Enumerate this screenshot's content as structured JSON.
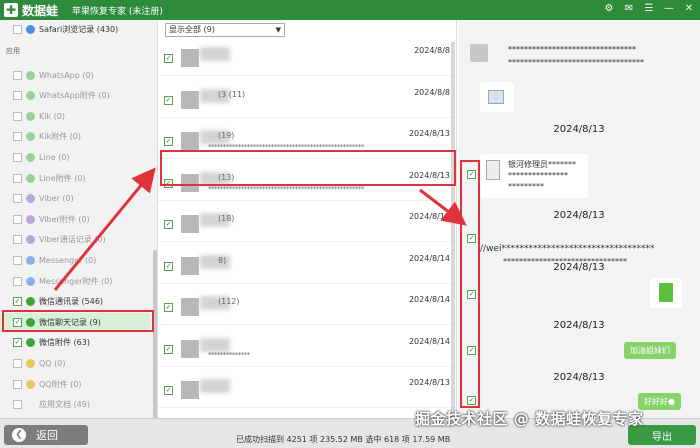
{
  "titlebar": {
    "logo_mark": "✚",
    "logo_text": "数据蛙",
    "app_title": "苹果恢复专家 (未注册)",
    "controls": [
      "⚙",
      "✉",
      "☰",
      "—",
      "✕"
    ]
  },
  "sidebar": {
    "top_item": "Safari浏览记录 (430)",
    "section_label": "应用",
    "items": [
      {
        "label": "WhatsApp (0)",
        "checked": false,
        "icon_color": "#9ad09a"
      },
      {
        "label": "WhatsApp附件 (0)",
        "checked": false,
        "icon_color": "#9ad09a"
      },
      {
        "label": "Kik (0)",
        "checked": false,
        "icon_color": "#9ad09a"
      },
      {
        "label": "Kik附件 (0)",
        "checked": false,
        "icon_color": "#9ad09a"
      },
      {
        "label": "Line (0)",
        "checked": false,
        "icon_color": "#9ad09a"
      },
      {
        "label": "Line附件 (0)",
        "checked": false,
        "icon_color": "#9ad09a"
      },
      {
        "label": "Viber (0)",
        "checked": false,
        "icon_color": "#b8a8d8"
      },
      {
        "label": "Viber附件 (0)",
        "checked": false,
        "icon_color": "#b8a8d8"
      },
      {
        "label": "Viber通话记录 (0)",
        "checked": false,
        "icon_color": "#b8a8d8"
      },
      {
        "label": "Messenger (0)",
        "checked": false,
        "icon_color": "#8ab0e8"
      },
      {
        "label": "Messenger附件 (0)",
        "checked": false,
        "icon_color": "#8ab0e8"
      },
      {
        "label": "微信通讯录 (546)",
        "checked": true,
        "icon_color": "#3aa53a"
      },
      {
        "label": "微信聊天记录 (9)",
        "checked": true,
        "icon_color": "#3aa53a"
      },
      {
        "label": "微信附件 (63)",
        "checked": true,
        "icon_color": "#3aa53a"
      },
      {
        "label": "QQ (0)",
        "checked": false,
        "icon_color": "#e8c85a"
      },
      {
        "label": "QQ附件 (0)",
        "checked": false,
        "icon_color": "#e8c85a"
      },
      {
        "label": "应用文档 (49)",
        "checked": false,
        "icon_color": ""
      }
    ]
  },
  "middle": {
    "filter_value": "显示全部 (9)",
    "rows": [
      {
        "name": "",
        "date": "2024/8/8",
        "preview": "",
        "highlighted": false
      },
      {
        "name": "(3 (11)",
        "date": "2024/8/8",
        "preview": "",
        "highlighted": false
      },
      {
        "name": "(19)",
        "date": "2024/8/13",
        "preview": "****************************************************",
        "highlighted": false
      },
      {
        "name": "(13)",
        "date": "2024/8/13",
        "preview": "****************************************************",
        "highlighted": true
      },
      {
        "name": "(18)",
        "date": "2024/8/13",
        "preview": "",
        "highlighted": false
      },
      {
        "name": "8)",
        "date": "2024/8/14",
        "preview": "",
        "highlighted": false
      },
      {
        "name": "(112)",
        "date": "2024/8/14",
        "preview": "",
        "highlighted": false
      },
      {
        "name": "",
        "date": "2024/8/14",
        "preview": "**************",
        "highlighted": false
      },
      {
        "name": "",
        "date": "2024/8/13",
        "preview": "",
        "highlighted": false
      }
    ]
  },
  "chat": {
    "top_line1": "********************************",
    "top_line2": "**********************************",
    "date1": "2024/8/13",
    "file_text": [
      "银河修理员*******",
      "***************",
      "*********"
    ],
    "date2": "2024/8/13",
    "wei_line1": "//wei**********************************",
    "wei_line2": "*******************************",
    "date3": "2024/8/13",
    "date4": "2024/8/13",
    "bubble1": "加油姐妹们",
    "date5": "2024/8/13",
    "bubble2": "好好好●"
  },
  "bottom": {
    "back_label": "返回",
    "back_icon": "❮",
    "status": "已成功扫描到 4251 项 235.52 MB  选中 618 项 17.59 MB",
    "export_label": "导出",
    "watermark": "掘金技术社区 @ 数据蛙恢复专家"
  }
}
